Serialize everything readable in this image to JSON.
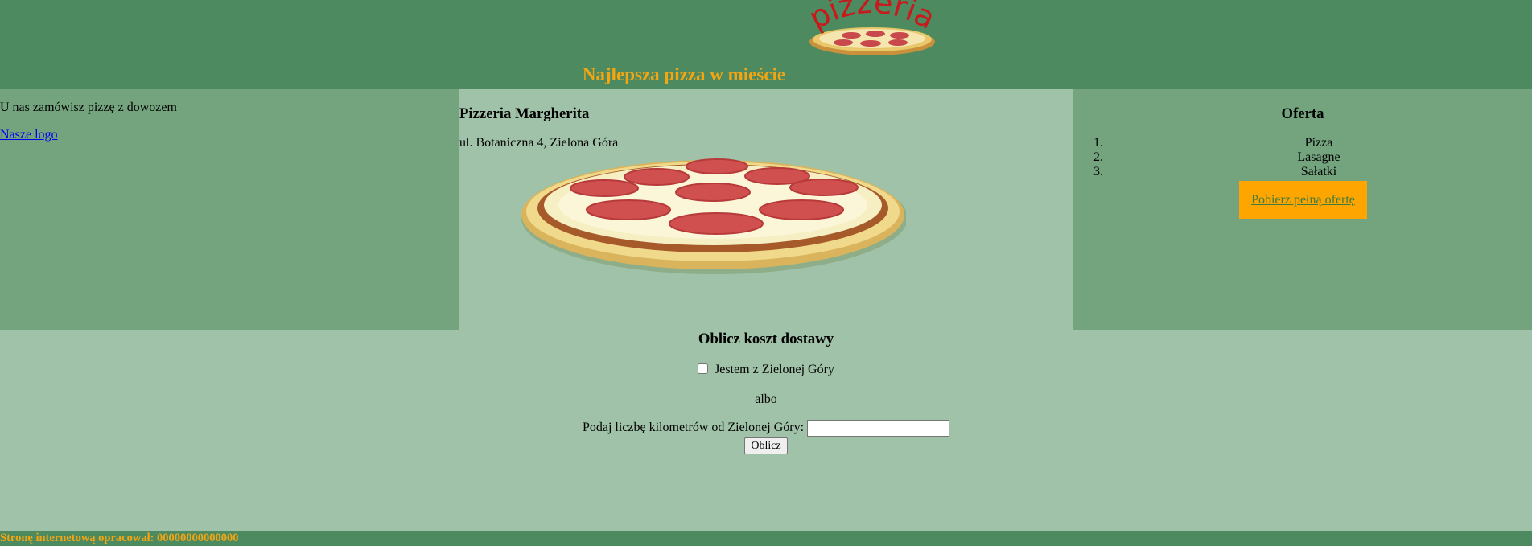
{
  "header": {
    "logo_text": "pizzeria",
    "title": "Najlepsza pizza w mieście"
  },
  "left": {
    "intro": "U nas zamówisz pizzę z dowozem",
    "logo_link": "Nasze logo"
  },
  "center": {
    "name": "Pizzeria Margherita",
    "address": "ul. Botaniczna 4, Zielona Góra"
  },
  "right": {
    "heading": "Oferta",
    "items": [
      {
        "num": "1.",
        "label": "Pizza"
      },
      {
        "num": "2.",
        "label": "Lasagne"
      },
      {
        "num": "3.",
        "label": "Sałatki"
      }
    ],
    "download_link": "Pobierz pełną ofertę"
  },
  "calc": {
    "heading": "Oblicz koszt dostawy",
    "checkbox_label": "Jestem z Zielonej Góry",
    "or_text": "albo",
    "km_label": "Podaj liczbę kilometrów od Zielonej Góry:",
    "km_value": "",
    "button_label": "Oblicz"
  },
  "footer": {
    "text": "Stronę internetową opracował: 00000000000000"
  },
  "colors": {
    "header_bg": "#4e8a60",
    "side_bg": "#73a47e",
    "main_bg": "#a0c2a8",
    "accent": "#f3a512",
    "button_bg": "#ffa500"
  }
}
